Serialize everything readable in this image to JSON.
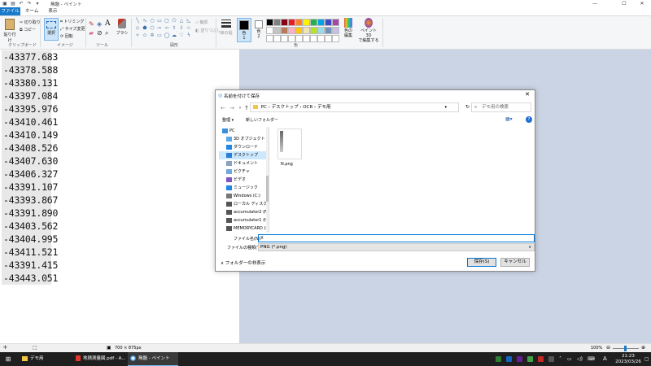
{
  "window": {
    "title": "無題 - ペイント",
    "controls": {
      "minimize": "—",
      "maximize": "☐",
      "close": "✕"
    }
  },
  "ribbon_tabs": [
    "ファイル",
    "ホーム",
    "表示"
  ],
  "ribbon": {
    "clipboard": {
      "paste": "貼り付け",
      "cut": "切り取り",
      "copy": "コピー",
      "label": "クリップボード"
    },
    "image": {
      "select": "選択",
      "crop": "トリミング",
      "resize": "サイズ変更",
      "rotate": "回転",
      "label": "イメージ"
    },
    "tools": {
      "label": "ツール",
      "brush": "ブラシ"
    },
    "shapes": {
      "outline": "輪郭",
      "fill": "塗りつぶし",
      "label": "図形"
    },
    "size": {
      "label": "線の幅"
    },
    "colors": {
      "color1": "色\n1",
      "color2": "色\n2",
      "edit": "色の\n編集",
      "paint3d": "ペイント 3D\nで編集する",
      "label": "色"
    }
  },
  "palette": [
    "#000000",
    "#7f7f7f",
    "#880015",
    "#ed1c24",
    "#ff7f27",
    "#fff200",
    "#22b14c",
    "#00a2e8",
    "#3f48cc",
    "#a349a4",
    "#ffffff",
    "#c3c3c3",
    "#b97a57",
    "#ffaec9",
    "#ffc90e",
    "#efe4b0",
    "#b5e61d",
    "#99d9ea",
    "#7092be",
    "#c8bfe7"
  ],
  "canvas_values": [
    "-43377.683",
    "-43378.588",
    "-43380.131",
    "-43397.084",
    "-43395.976",
    "-43410.461",
    "-43410.149",
    "-43408.526",
    "-43407.630",
    "-43406.327",
    "-43391.107",
    "-43393.867",
    "-43391.890",
    "-43403.562",
    "-43404.995",
    "-43411.521",
    "-43391.415",
    "-43443.051"
  ],
  "statusbar": {
    "dimensions": "700 × 875px",
    "zoom": "100%"
  },
  "dialog": {
    "title": "名前を付けて保存",
    "breadcrumb": "PC  ›  デスクトップ  ›  OCR  ›  デモ用",
    "search_placeholder": "デモ用の検索",
    "organize": "整理 ▾",
    "new_folder": "新しいフォルダー",
    "nav_items": [
      "PC",
      "3D オブジェクト",
      "ダウンロード",
      "デスクトップ",
      "ドキュメント",
      "ピクチャ",
      "ビデオ",
      "ミュージック",
      "Windows (C:)",
      "ローカル ディスク (D:)",
      "accumulator2 (F:)",
      "accumulator1 (H:)",
      "MEMORYCARD (I:)"
    ],
    "file": "N.png",
    "filename_label": "ファイル名(N):",
    "filename_value": "X",
    "filetype_label": "ファイルの種類(T):",
    "filetype_value": "PNG (*.png)",
    "hide_folders": "フォルダーの非表示",
    "save": "保存(S)",
    "cancel": "キャンセル"
  },
  "taskbar": {
    "items": [
      "デモ用",
      "地積測量図.pdf - A...",
      "無題 - ペイント"
    ],
    "ime": "A",
    "time": "21:23",
    "date": "2023/03/26"
  }
}
